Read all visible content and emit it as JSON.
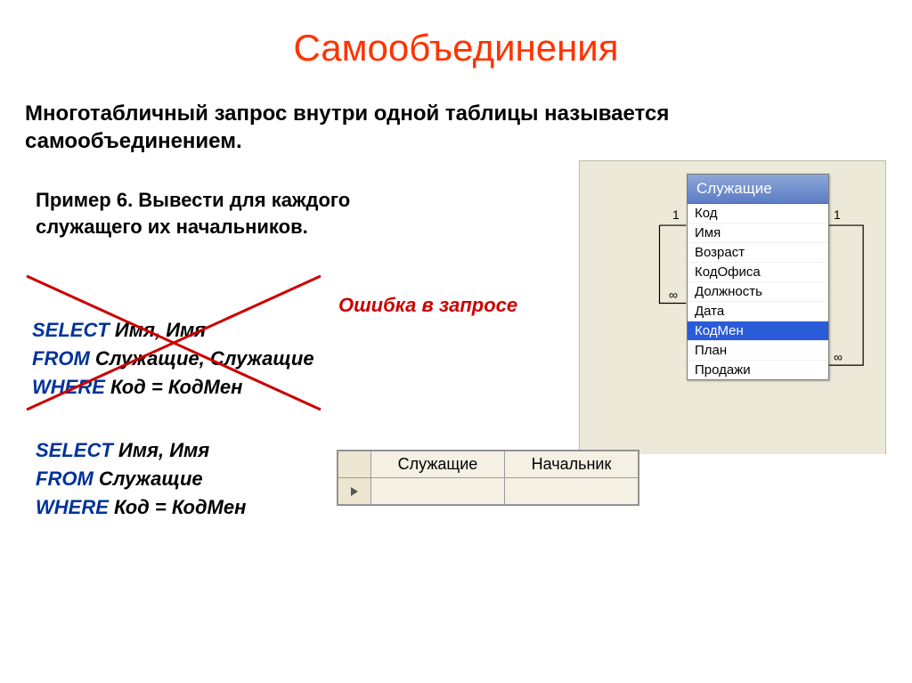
{
  "title": "Самообъединения",
  "definition": "Многотабличный запрос внутри одной таблицы называется самообъединением.",
  "example_prompt": "Пример 6. Вывести для каждого служащего их начальников.",
  "error_label": "Ошибка в запросе",
  "sql1": {
    "select_kw": "SELECT",
    "select_fields": "Имя, Имя",
    "from_kw": "FROM",
    "from_tables": "Служащие, Служащие",
    "where_kw": "WHERE",
    "where_cond": "Код = КодМен"
  },
  "sql2": {
    "select_kw": "SELECT",
    "select_fields": "Имя, Имя",
    "from_kw": "FROM",
    "from_tables": "Служащие",
    "where_kw": "WHERE",
    "where_cond": "Код = КодМен"
  },
  "table_name": "Служащие",
  "table_fields": [
    "Код",
    "Имя",
    "Возраст",
    "КодОфиса",
    "Должность",
    "Дата",
    "КодМен",
    "План",
    "Продажи"
  ],
  "selected_field": "КодМен",
  "multiplicities": {
    "left1": "1",
    "right1": "1",
    "left_inf": "∞",
    "right_inf": "∞"
  },
  "result_headers": [
    "Служащие",
    "Начальник"
  ]
}
